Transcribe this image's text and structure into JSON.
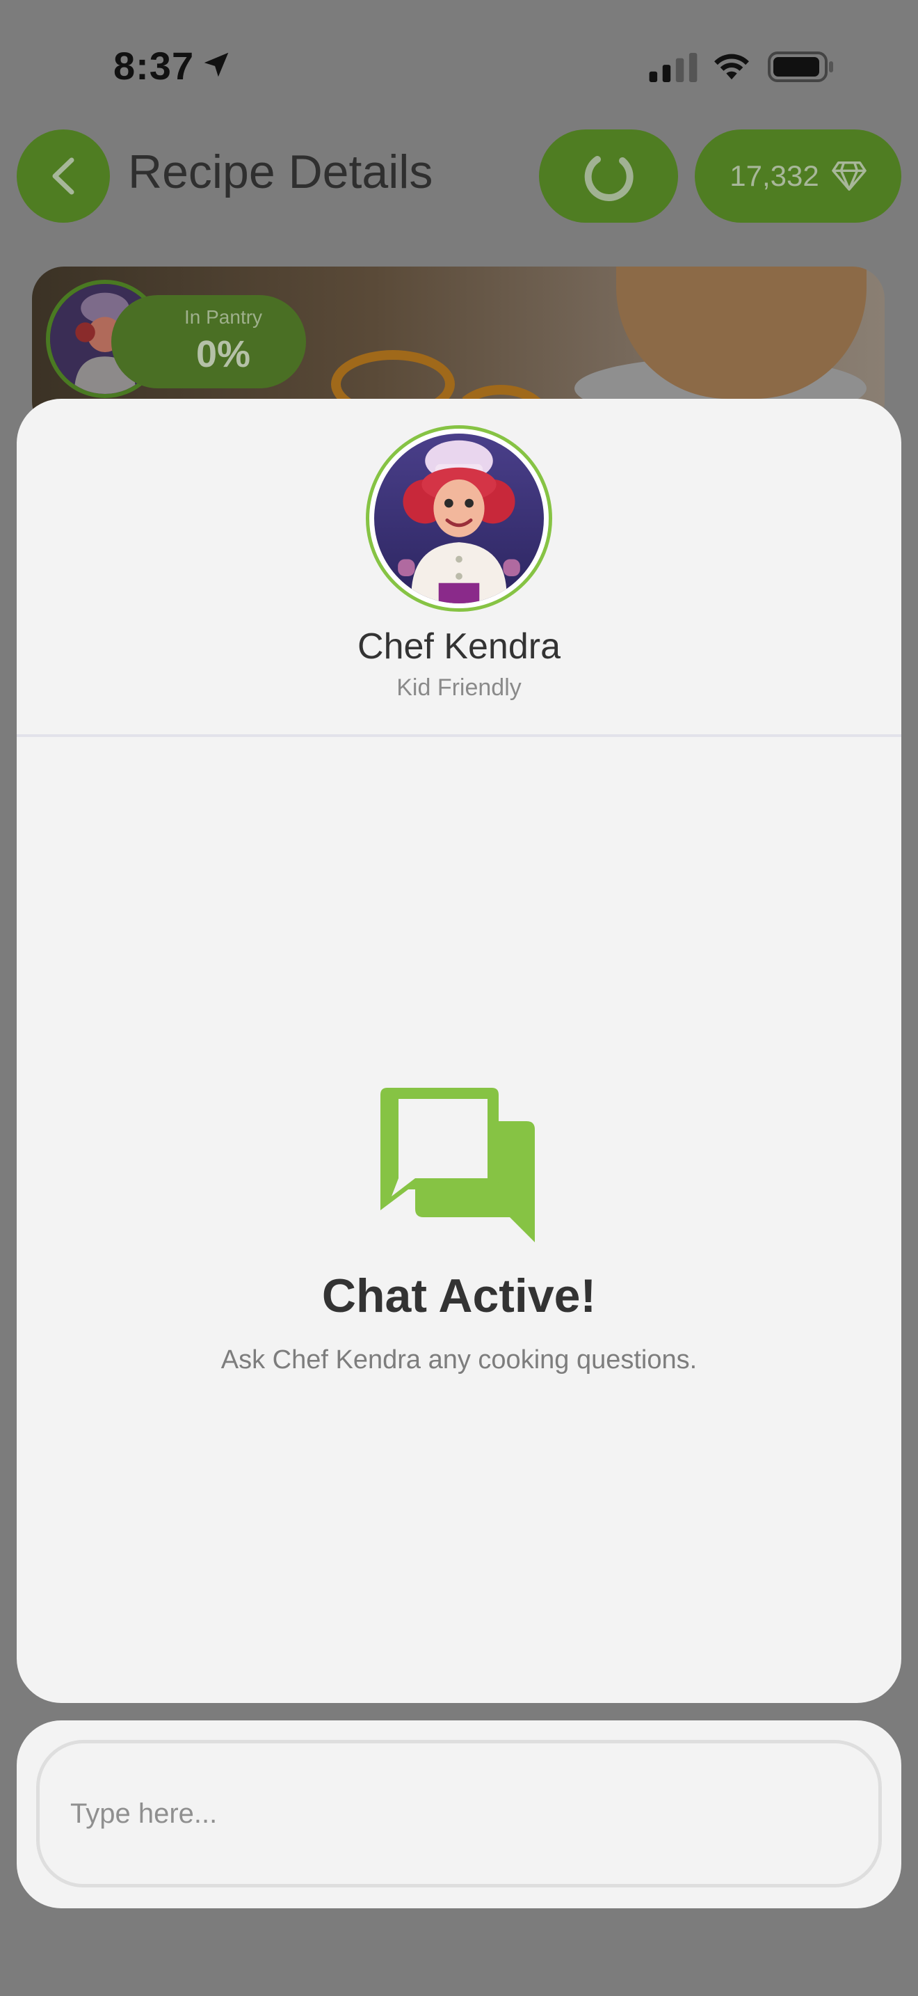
{
  "status_bar": {
    "time": "8:37"
  },
  "header": {
    "title": "Recipe Details",
    "gems": "17,332"
  },
  "recipe_card": {
    "pantry_label": "In Pantry",
    "pantry_value": "0%"
  },
  "chef": {
    "name": "Chef Kendra",
    "subtitle": "Kid Friendly"
  },
  "chat": {
    "title": "Chat Active!",
    "description": "Ask Chef Kendra any cooking questions.",
    "input_placeholder": "Type here...",
    "input_value": ""
  },
  "colors": {
    "accent": "#86c344",
    "overlay": "#7c7c7c",
    "sheet_bg": "#f3f3f3",
    "dim_button": "#4f7d22"
  },
  "icons": [
    "location-arrow-icon",
    "cellular-signal-icon",
    "wifi-icon",
    "battery-icon",
    "chevron-left-icon",
    "loading-spinner-icon",
    "diamond-icon",
    "chat-bubbles-icon"
  ]
}
